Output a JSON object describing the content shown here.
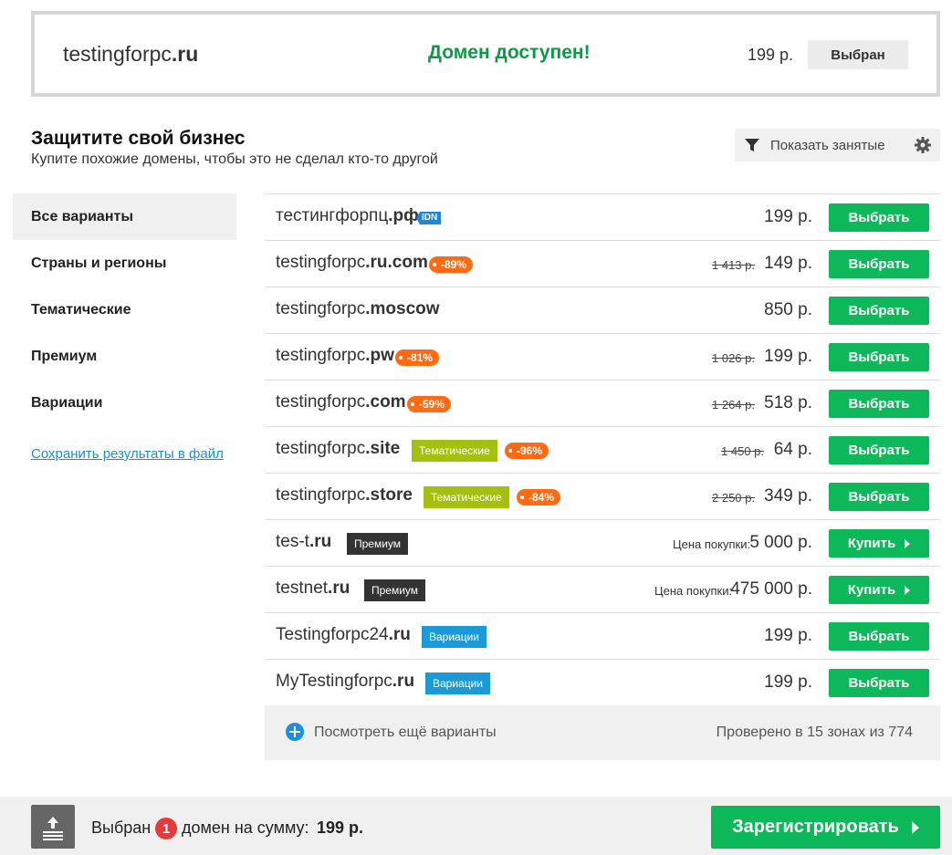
{
  "hero": {
    "domain_name": "testingforpc",
    "domain_zone": ".ru",
    "status": "Домен доступен!",
    "price": "199 р.",
    "button_label": "Выбран"
  },
  "section": {
    "title": "Защитите свой бизнес",
    "subtitle": "Купите похожие домены, чтобы это не сделал кто-то другой",
    "filter_label": "Показать занятые"
  },
  "sidebar": {
    "items": [
      {
        "label": "Все варианты",
        "active": true
      },
      {
        "label": "Страны и регионы",
        "active": false
      },
      {
        "label": "Тематические",
        "active": false
      },
      {
        "label": "Премиум",
        "active": false
      },
      {
        "label": "Вариации",
        "active": false
      }
    ],
    "save_link": "Сохранить результаты в файл"
  },
  "results": [
    {
      "name": "тестингфорпц",
      "zone": ".рф",
      "idn": "IDN",
      "price": "199 р.",
      "button": "Выбрать"
    },
    {
      "name": "testingforpc",
      "zone": ".ru.com",
      "discount": "-89%",
      "old_price": "1 413 р.",
      "price": "149 р.",
      "button": "Выбрать"
    },
    {
      "name": "testingforpc",
      "zone": ".moscow",
      "price": "850 р.",
      "button": "Выбрать"
    },
    {
      "name": "testingforpc",
      "zone": ".pw",
      "discount": "-81%",
      "old_price": "1 026 р.",
      "price": "199 р.",
      "button": "Выбрать"
    },
    {
      "name": "testingforpc",
      "zone": ".com",
      "discount": "-59%",
      "old_price": "1 264 р.",
      "price": "518 р.",
      "button": "Выбрать"
    },
    {
      "name": "testingforpc",
      "zone": ".site",
      "category": "Тематические",
      "discount": "-96%",
      "old_price": "1 450 р.",
      "price": "64 р.",
      "button": "Выбрать"
    },
    {
      "name": "testingforpc",
      "zone": ".store",
      "category": "Тематические",
      "discount": "-84%",
      "old_price": "2 250 р.",
      "price": "349 р.",
      "button": "Выбрать"
    },
    {
      "name": "tes-t",
      "zone": ".ru",
      "category": "Премиум",
      "price_label": "Цена покупки:",
      "price": "5 000 р.",
      "button": "Купить"
    },
    {
      "name": "testnet",
      "zone": ".ru",
      "category": "Премиум",
      "price_label": "Цена покупки:",
      "price": "475 000 р.",
      "button": "Купить"
    },
    {
      "name": "Testingforpc24",
      "zone": ".ru",
      "category": "Вариации",
      "price": "199 р.",
      "button": "Выбрать"
    },
    {
      "name": "MyTestingforpc",
      "zone": ".ru",
      "category": "Вариации",
      "price": "199 р.",
      "button": "Выбрать"
    }
  ],
  "more": {
    "label": "Посмотреть ещё варианты",
    "checked": "Проверено в 15 зонах из 774"
  },
  "footer": {
    "selected_prefix": "Выбран",
    "count": "1",
    "selected_suffix": "домен на сумму:",
    "total": "199 р.",
    "register_label": "Зарегистрировать"
  },
  "colors": {
    "accent_green": "#0db85b",
    "status_green": "#0a9a48",
    "discount_orange": "#ff6a13",
    "category_thematic": "#a6c00f",
    "category_premium": "#333333",
    "category_variation": "#1b9ad6",
    "count_badge": "#e33b3b"
  },
  "icons": [
    "filter-icon",
    "gear-icon",
    "plus-circle-icon",
    "upload-icon",
    "arrow-right-icon"
  ]
}
